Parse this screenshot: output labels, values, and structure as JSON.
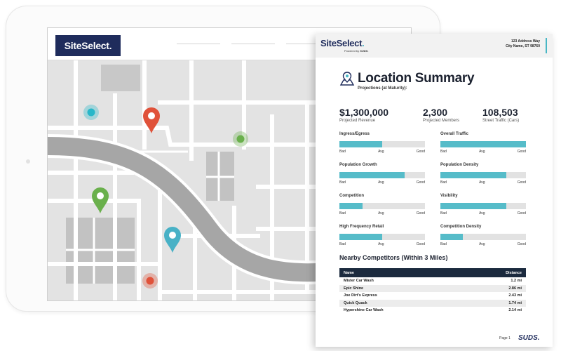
{
  "app": {
    "logo": "SiteSelect."
  },
  "map": {
    "markers": [
      {
        "name": "marker-red",
        "color": "#e0523a",
        "type": "pin"
      },
      {
        "name": "marker-green",
        "color": "#6ab04c",
        "type": "pin"
      },
      {
        "name": "marker-teal",
        "color": "#48b1c6",
        "type": "pin"
      },
      {
        "name": "marker-teal-dot",
        "color": "#28b7c9",
        "type": "dot"
      },
      {
        "name": "marker-green-dot",
        "color": "#6ab04c",
        "type": "dot"
      },
      {
        "name": "marker-red-dot",
        "color": "#e0523a",
        "type": "dot"
      }
    ]
  },
  "report": {
    "brand": "SiteSelect",
    "brand_dot": ".",
    "powered_by_prefix": "Powered by ",
    "powered_by_brand": "SUDS.",
    "address_line1": "123 Address Way",
    "address_line2": "City Name, ST 98760",
    "title": "Location Summary",
    "subtitle": "Projections (at Maturity):",
    "metrics": [
      {
        "value": "$1,300,000",
        "label": "Projected Revenue"
      },
      {
        "value": "2,300",
        "label": "Projected Members"
      },
      {
        "value": "108,503",
        "label": "Street Traffic (Cars)"
      }
    ],
    "scale": {
      "bad": "Bad",
      "avg": "Avg",
      "good": "Good"
    },
    "ratings": [
      {
        "label": "Ingress/Egress",
        "level": 0.5
      },
      {
        "label": "Overall Traffic",
        "level": 1.0
      },
      {
        "label": "Population Growth",
        "level": 0.76
      },
      {
        "label": "Population Density",
        "level": 0.77
      },
      {
        "label": "Competition",
        "level": 0.27
      },
      {
        "label": "Visibility",
        "level": 0.77
      },
      {
        "label": "High Frequency Retail",
        "level": 0.5
      },
      {
        "label": "Competition Density",
        "level": 0.26
      }
    ],
    "competitors_title": "Nearby Competitors (Within 3 Miles)",
    "competitors_headers": {
      "name": "Name",
      "distance": "Distance"
    },
    "competitors": [
      {
        "name": "Mister Car Wash",
        "distance": "1.2 mi"
      },
      {
        "name": "Epic Shine",
        "distance": "2.86 mi"
      },
      {
        "name": "Joe Dirt's Express",
        "distance": "2.43 mi"
      },
      {
        "name": "Quick Quack",
        "distance": "1.74 mi"
      },
      {
        "name": "Hypershine Car Wash",
        "distance": "2.14 mi"
      }
    ],
    "page_label": "Page 1",
    "footer_logo": "SUDS."
  },
  "colors": {
    "navy": "#1f2c5c",
    "accent": "#56bcc9",
    "table_header": "#1b2a3e"
  }
}
